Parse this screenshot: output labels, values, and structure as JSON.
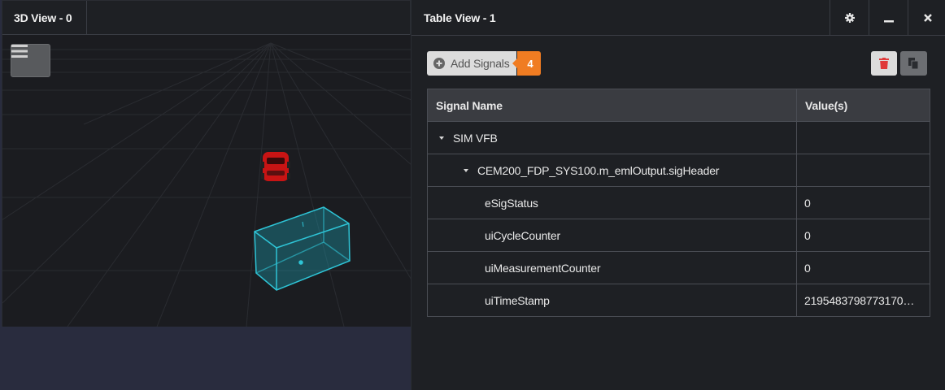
{
  "view3d": {
    "tab_title": "3D View - 0",
    "menu_icon": "hamburger-icon"
  },
  "table_view": {
    "tab_title": "Table View - 1",
    "controls": {
      "settings_icon": "gear-icon",
      "minimize_icon": "minimize-icon",
      "close_icon": "close-icon"
    },
    "add_signals_label": "Add Signals",
    "signal_count": "4",
    "delete_icon": "trash-icon",
    "copy_icon": "copy-icon",
    "colors": {
      "accent": "#f07c22",
      "delete": "#e03a3a",
      "selection_box": "#2ec4d6",
      "car": "#c81414"
    },
    "columns": [
      "Signal Name",
      "Value(s)"
    ],
    "rows": [
      {
        "name": "SIM VFB",
        "value": "",
        "level": 0,
        "expanded": true
      },
      {
        "name": "CEM200_FDP_SYS100.m_emlOutput.sigHeader",
        "value": "",
        "level": 1,
        "expanded": true
      },
      {
        "name": "eSigStatus",
        "value": "0",
        "level": 2
      },
      {
        "name": "uiCycleCounter",
        "value": "0",
        "level": 2
      },
      {
        "name": "uiMeasurementCounter",
        "value": "0",
        "level": 2
      },
      {
        "name": "uiTimeStamp",
        "value": "2195483798773170…",
        "level": 2
      }
    ]
  }
}
